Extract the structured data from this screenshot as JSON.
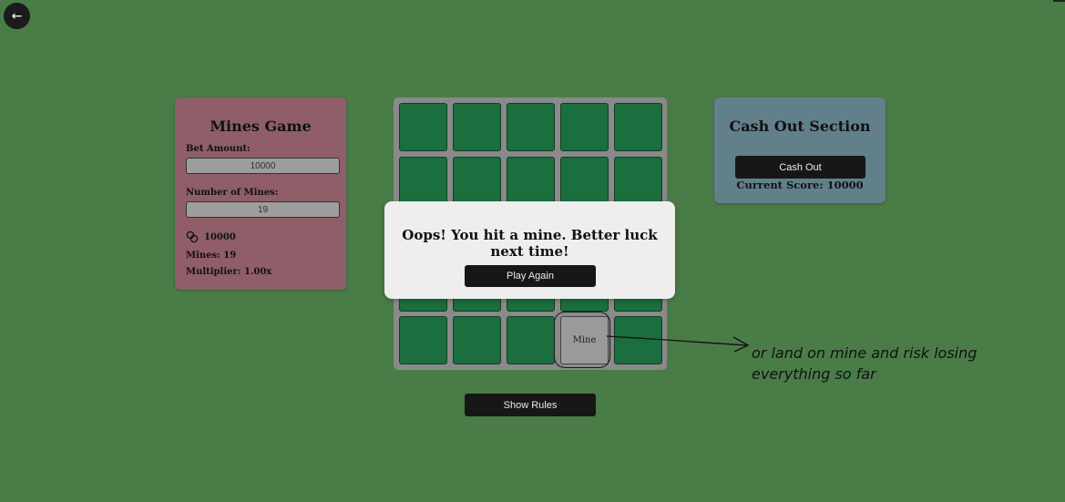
{
  "nav": {
    "back_icon": "arrow-left-icon",
    "back_glyph": "←"
  },
  "game_panel": {
    "title": "Mines Game",
    "bet_label": "Bet Amount:",
    "bet_value": "10000",
    "mines_label": "Number of Mines:",
    "mines_value": "19",
    "balance_icon": "coins-icon",
    "balance": "10000",
    "mines_stat": "Mines: 19",
    "multiplier_stat": "Multiplier: 1.00x"
  },
  "grid": {
    "rows": 5,
    "cols": 5,
    "revealed_tile": {
      "row": 5,
      "col": 4,
      "alt_text": "Mine"
    }
  },
  "cashout_panel": {
    "title": "Cash Out Section",
    "button_label": "Cash Out",
    "current_score": "Current Score: 10000"
  },
  "modal": {
    "message": "Oops! You hit a mine. Better luck next time!",
    "button_label": "Play Again"
  },
  "rules_button_label": "Show Rules",
  "annotation": {
    "line1": "or land on mine and risk losing",
    "line2": "everything so far"
  },
  "colors": {
    "background": "#4a7c48",
    "game_panel": "#8f5e68",
    "cashout_panel": "#62808a",
    "tile": "#1b6e3e",
    "grid_frame": "#8a8a8a"
  }
}
